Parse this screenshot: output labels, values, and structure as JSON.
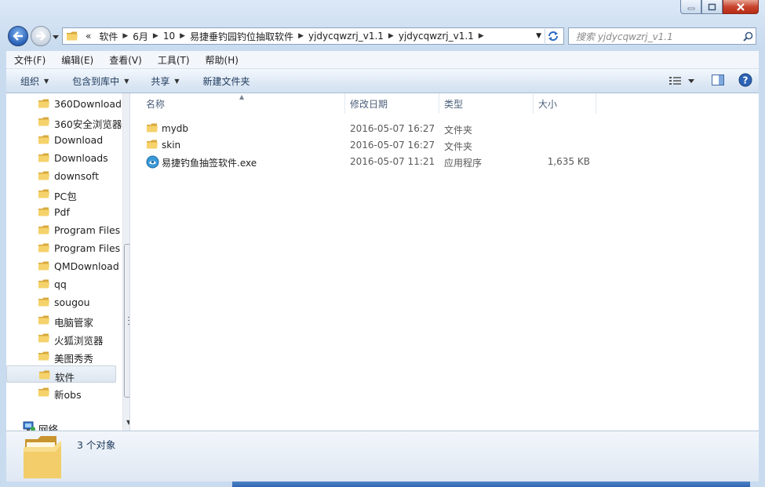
{
  "address": {
    "overflow": "«",
    "crumbs": [
      "软件",
      "6月",
      "10",
      "易捷垂钓园钓位抽取软件",
      "yjdycqwzrj_v1.1",
      "yjdycqwzrj_v1.1"
    ]
  },
  "search": {
    "placeholder": "搜索 yjdycqwzrj_v1.1"
  },
  "menu": [
    "文件(F)",
    "编辑(E)",
    "查看(V)",
    "工具(T)",
    "帮助(H)"
  ],
  "toolbar": {
    "organize": "组织",
    "include_in_library": "包含到库中",
    "share": "共享",
    "new_folder": "新建文件夹"
  },
  "nav_items": [
    {
      "label": "360Download",
      "icon": "folder-icon"
    },
    {
      "label": "360安全浏览器",
      "icon": "folder-icon"
    },
    {
      "label": "Download",
      "icon": "folder-icon"
    },
    {
      "label": "Downloads",
      "icon": "folder-icon"
    },
    {
      "label": "downsoft",
      "icon": "folder-icon"
    },
    {
      "label": "PC包",
      "icon": "folder-icon"
    },
    {
      "label": "Pdf",
      "icon": "folder-icon"
    },
    {
      "label": "Program Files",
      "icon": "folder-icon"
    },
    {
      "label": "Program Files",
      "icon": "folder-icon"
    },
    {
      "label": "QMDownload",
      "icon": "folder-icon"
    },
    {
      "label": "qq",
      "icon": "folder-icon"
    },
    {
      "label": "sougou",
      "icon": "folder-icon"
    },
    {
      "label": "电脑管家",
      "icon": "folder-icon"
    },
    {
      "label": "火狐浏览器",
      "icon": "folder-icon"
    },
    {
      "label": "美图秀秀",
      "icon": "folder-icon"
    },
    {
      "label": "软件",
      "icon": "folder-icon",
      "selected": true
    },
    {
      "label": "新obs",
      "icon": "folder-icon"
    }
  ],
  "network_label": "网络",
  "columns": {
    "name": "名称",
    "date": "修改日期",
    "type": "类型",
    "size": "大小"
  },
  "files": [
    {
      "name": "mydb",
      "date": "2016-05-07 16:27",
      "type": "文件夹",
      "size": "",
      "icon": "folder-icon"
    },
    {
      "name": "skin",
      "date": "2016-05-07 16:27",
      "type": "文件夹",
      "size": "",
      "icon": "folder-icon"
    },
    {
      "name": "易捷钓鱼抽签软件.exe",
      "date": "2016-05-07 11:21",
      "type": "应用程序",
      "size": "1,635 KB",
      "icon": "app-icon"
    }
  ],
  "details": {
    "count": "3 个对象"
  }
}
